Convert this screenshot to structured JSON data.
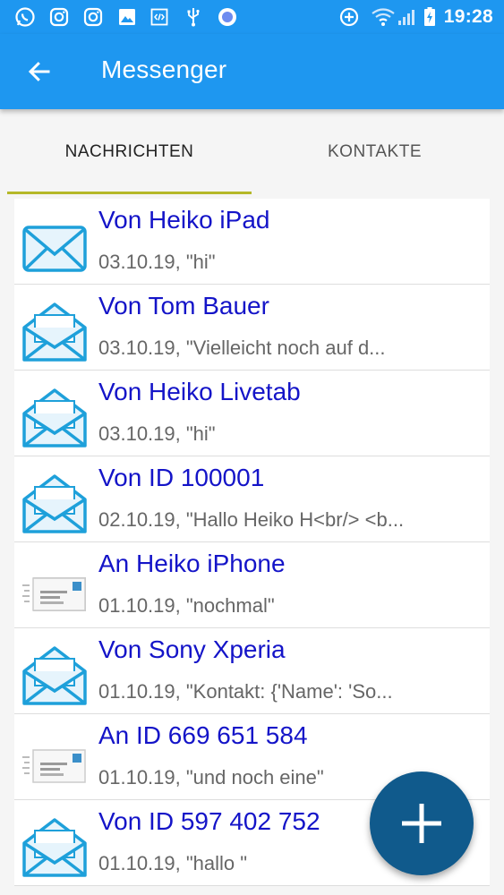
{
  "status_bar": {
    "time": "19:28",
    "icons": [
      "whatsapp-icon",
      "instagram-icon",
      "instagram-icon",
      "image-icon",
      "code-icon",
      "usb-icon",
      "circle-icon",
      "data-saver-icon",
      "wifi-icon",
      "signal-icon",
      "battery-charging-icon"
    ]
  },
  "app_bar": {
    "title": "Messenger",
    "back_icon": "arrow-back-icon",
    "color": "#1e97f0"
  },
  "tabs": [
    {
      "label": "NACHRICHTEN",
      "selected": true
    },
    {
      "label": "KONTAKTE",
      "selected": false
    }
  ],
  "accent": {
    "tab_indicator": "#b5b829",
    "title_text": "#1414c8",
    "fab": "#105a8c"
  },
  "messages": [
    {
      "title": "Von Heiko iPad",
      "preview": "03.10.19, \"hi\"",
      "icon": "envelope-closed-icon"
    },
    {
      "title": "Von Tom Bauer",
      "preview": "03.10.19, \"Vielleicht noch auf d...",
      "icon": "envelope-open-icon"
    },
    {
      "title": "Von Heiko Livetab",
      "preview": "03.10.19, \"hi\"",
      "icon": "envelope-open-icon"
    },
    {
      "title": "Von ID 100001",
      "preview": "02.10.19, \"Hallo Heiko H<br/> <b...",
      "icon": "envelope-open-icon"
    },
    {
      "title": "An Heiko iPhone",
      "preview": "01.10.19, \"nochmal\"",
      "icon": "sent-letter-icon"
    },
    {
      "title": "Von Sony Xperia",
      "preview": "01.10.19, \"Kontakt: {'Name': 'So...",
      "icon": "envelope-open-icon"
    },
    {
      "title": "An ID 669 651 584",
      "preview": "01.10.19, \"und noch eine\"",
      "icon": "sent-letter-icon"
    },
    {
      "title": "Von ID 597 402 752",
      "preview": "01.10.19, \"hallo \"",
      "icon": "envelope-open-icon"
    }
  ],
  "fab": {
    "icon": "plus-icon"
  }
}
